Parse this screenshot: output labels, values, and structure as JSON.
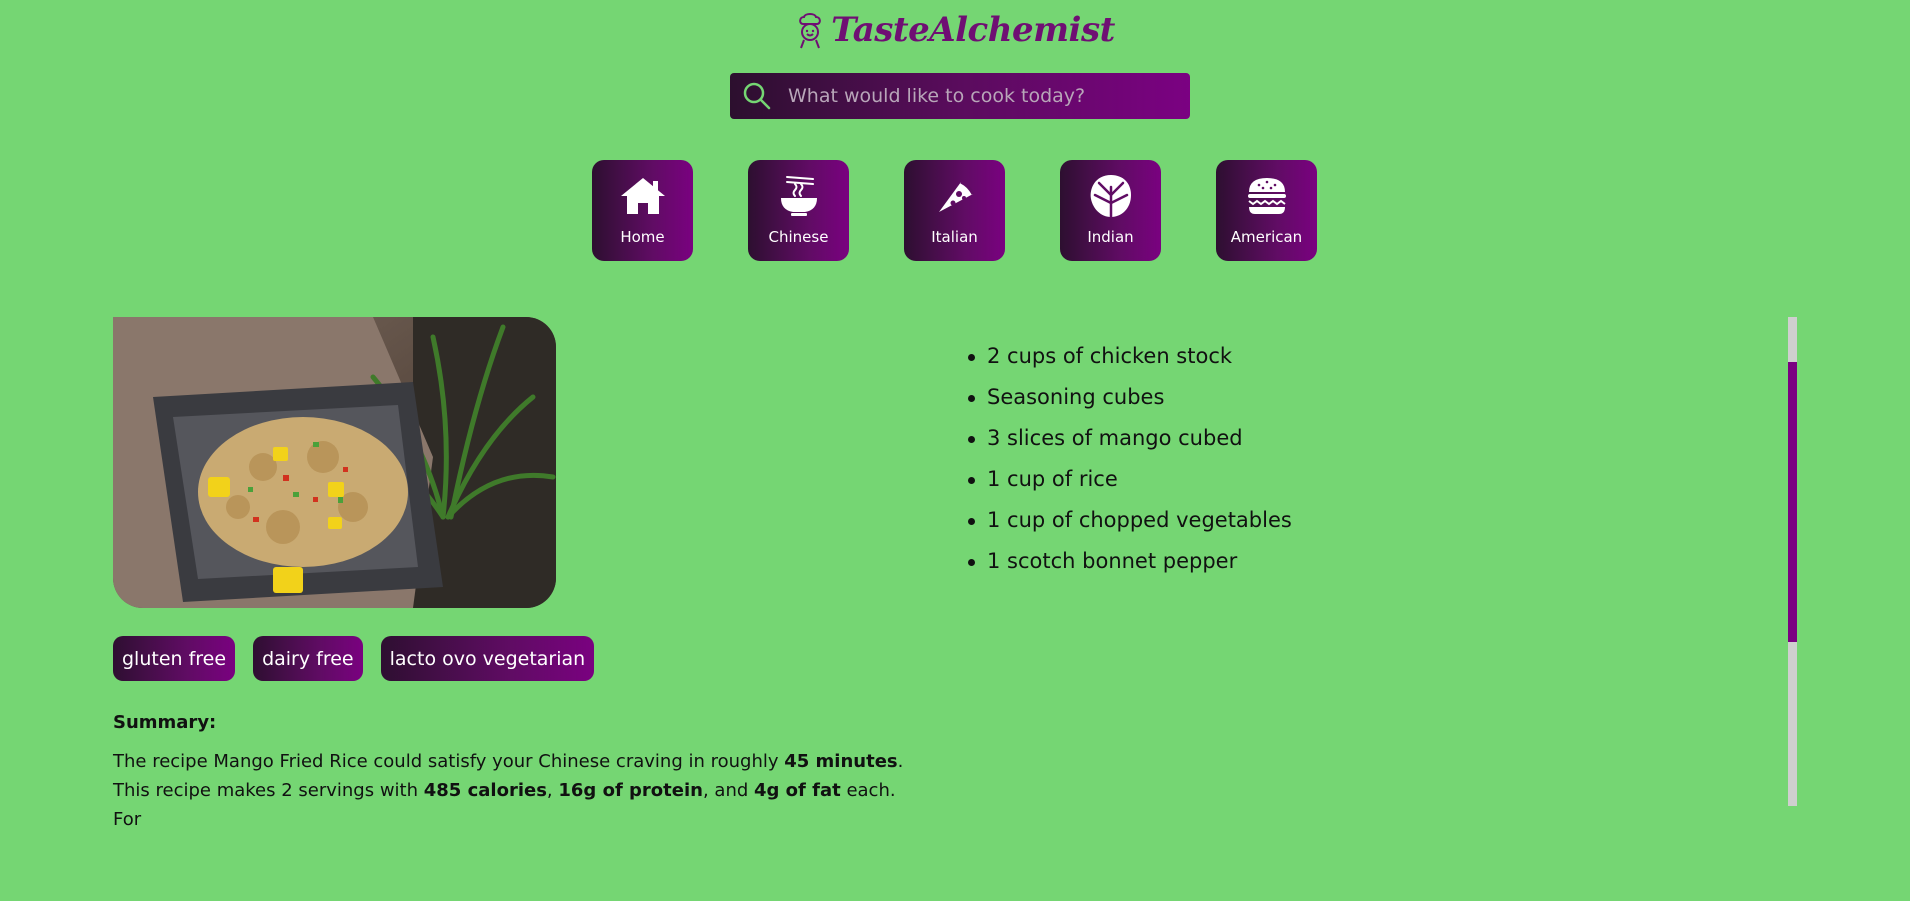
{
  "brand": {
    "name": "TasteAlchemist",
    "accent": "#6f0f73"
  },
  "search": {
    "placeholder": "What would like to cook today?",
    "value": ""
  },
  "nav": {
    "items": [
      {
        "label": "Home",
        "icon": "house-icon"
      },
      {
        "label": "Chinese",
        "icon": "noodle-bowl-icon"
      },
      {
        "label": "Italian",
        "icon": "pizza-slice-icon"
      },
      {
        "label": "Indian",
        "icon": "monstera-leaf-icon"
      },
      {
        "label": "American",
        "icon": "burger-icon"
      }
    ]
  },
  "recipe": {
    "image_alt": "Mango Fried Rice",
    "diet_tags": [
      "gluten free",
      "dairy free",
      "lacto ovo vegetarian"
    ],
    "summary_label": "Summary:",
    "summary": {
      "part1": "The recipe Mango Fried Rice could satisfy your Chinese craving in roughly ",
      "time": "45 minutes",
      "part2": ".",
      "part3": "This recipe makes 2 servings with ",
      "calories": "485 calories",
      "sep1": ", ",
      "protein": "16g of protein",
      "sep2": ", and ",
      "fat": "4g of fat",
      "part4": " each. For"
    },
    "ingredients": [
      "2 cups of chicken stock",
      "Seasoning cubes",
      "3 slices of mango cubed",
      "1 cup of rice",
      "1 cup of chopped vegetables",
      "1 scotch bonnet pepper"
    ]
  },
  "colors": {
    "background": "#75d673",
    "button_gradient_start": "#2d0f30",
    "button_gradient_end": "#7a0180",
    "scroll_thumb": "#7b0182"
  }
}
